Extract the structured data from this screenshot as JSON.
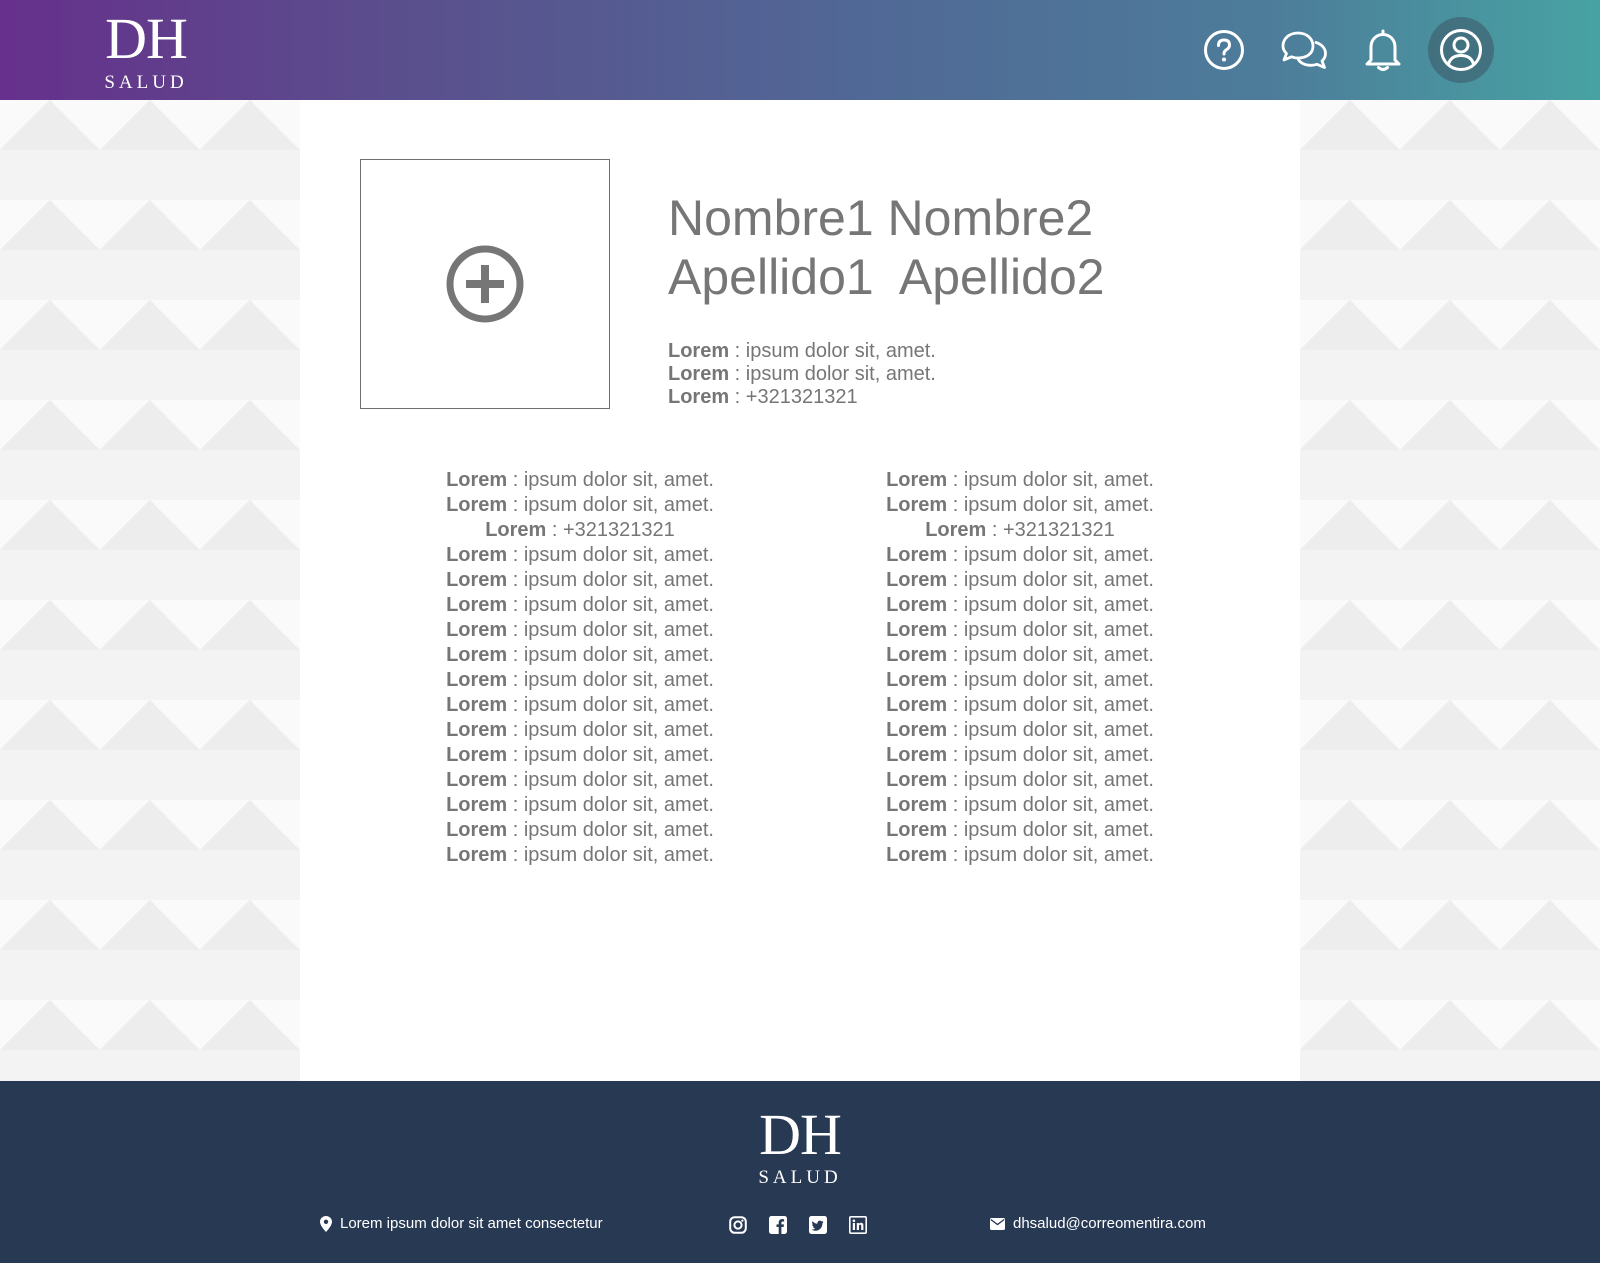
{
  "brand": {
    "logo_main": "DH",
    "logo_sub": "SALUD"
  },
  "header": {
    "icons": [
      "help-icon",
      "chat-icon",
      "bell-icon",
      "user-icon"
    ]
  },
  "profile": {
    "name_line1_a": "Nombre1",
    "name_line1_b": "Nombre2",
    "name_line2_a": "Apellido1",
    "name_line2_b": "Apellido2",
    "top_fields": [
      {
        "label": "Lorem",
        "value": " : ipsum dolor sit, amet."
      },
      {
        "label": "Lorem",
        "value": " : ipsum dolor sit, amet."
      },
      {
        "label": "Lorem",
        "value": " : +321321321"
      }
    ],
    "left_fields": [
      {
        "label": "Lorem",
        "value": " : ipsum dolor sit, amet."
      },
      {
        "label": "Lorem",
        "value": " : ipsum dolor sit, amet."
      },
      {
        "label": "Lorem",
        "value": " : +321321321"
      },
      {
        "label": "Lorem",
        "value": " : ipsum dolor sit, amet."
      },
      {
        "label": "Lorem",
        "value": " : ipsum dolor sit, amet."
      },
      {
        "label": "Lorem",
        "value": " : ipsum dolor sit, amet."
      },
      {
        "label": "Lorem",
        "value": " : ipsum dolor sit, amet."
      },
      {
        "label": "Lorem",
        "value": " : ipsum dolor sit, amet."
      },
      {
        "label": "Lorem",
        "value": " : ipsum dolor sit, amet."
      },
      {
        "label": "Lorem",
        "value": " : ipsum dolor sit, amet."
      },
      {
        "label": "Lorem",
        "value": " : ipsum dolor sit, amet."
      },
      {
        "label": "Lorem",
        "value": " : ipsum dolor sit, amet."
      },
      {
        "label": "Lorem",
        "value": " : ipsum dolor sit, amet."
      },
      {
        "label": "Lorem",
        "value": " : ipsum dolor sit, amet."
      },
      {
        "label": "Lorem",
        "value": " : ipsum dolor sit, amet."
      },
      {
        "label": "Lorem",
        "value": " : ipsum dolor sit, amet."
      }
    ],
    "right_fields": [
      {
        "label": "Lorem",
        "value": " : ipsum dolor sit, amet."
      },
      {
        "label": "Lorem",
        "value": " : ipsum dolor sit, amet."
      },
      {
        "label": "Lorem",
        "value": " : +321321321"
      },
      {
        "label": "Lorem",
        "value": " : ipsum dolor sit, amet."
      },
      {
        "label": "Lorem",
        "value": " : ipsum dolor sit, amet."
      },
      {
        "label": "Lorem",
        "value": " : ipsum dolor sit, amet."
      },
      {
        "label": "Lorem",
        "value": " : ipsum dolor sit, amet."
      },
      {
        "label": "Lorem",
        "value": " : ipsum dolor sit, amet."
      },
      {
        "label": "Lorem",
        "value": " : ipsum dolor sit, amet."
      },
      {
        "label": "Lorem",
        "value": " : ipsum dolor sit, amet."
      },
      {
        "label": "Lorem",
        "value": " : ipsum dolor sit, amet."
      },
      {
        "label": "Lorem",
        "value": " : ipsum dolor sit, amet."
      },
      {
        "label": "Lorem",
        "value": " : ipsum dolor sit, amet."
      },
      {
        "label": "Lorem",
        "value": " : ipsum dolor sit, amet."
      },
      {
        "label": "Lorem",
        "value": " : ipsum dolor sit, amet."
      },
      {
        "label": "Lorem",
        "value": " : ipsum dolor sit, amet."
      }
    ]
  },
  "footer": {
    "address": "Lorem ipsum dolor sit amet consectetur",
    "email": "dhsalud@correomentira.com",
    "socials": [
      "instagram-icon",
      "facebook-icon",
      "twitter-icon",
      "linkedin-icon"
    ]
  },
  "colors": {
    "header_gradient_start": "#66308c",
    "header_gradient_end": "#47a3a3",
    "footer_bg": "#283954",
    "text_gray": "#767676"
  }
}
